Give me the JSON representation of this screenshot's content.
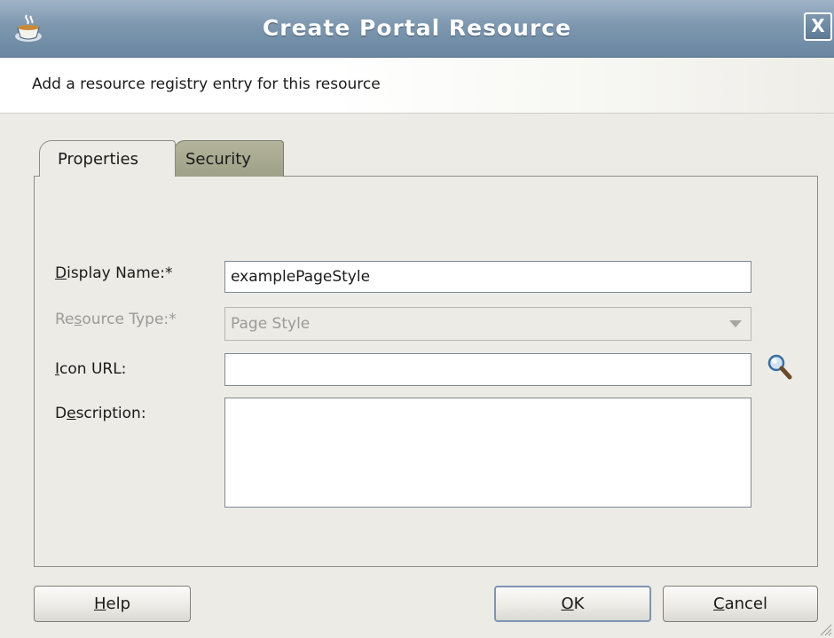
{
  "window": {
    "title": "Create Portal Resource",
    "close_label": "X"
  },
  "header": {
    "description": "Add a resource registry entry for this resource"
  },
  "tabs": [
    {
      "label": "Properties",
      "selected": true
    },
    {
      "label": "Security",
      "selected": false
    }
  ],
  "form": {
    "display_name": {
      "label_mnemonic": "D",
      "label_rest": "isplay Name:*",
      "value": "examplePageStyle"
    },
    "resource_type": {
      "label_pre": "Re",
      "label_mnemonic": "s",
      "label_rest": "ource Type:*",
      "value": "Page Style",
      "enabled": false
    },
    "icon_url": {
      "label_mnemonic": "I",
      "label_rest": "con URL:",
      "value": ""
    },
    "description": {
      "label_pre": "D",
      "label_mnemonic": "e",
      "label_rest": "scription:",
      "value": ""
    }
  },
  "buttons": {
    "help": {
      "mnemonic": "H",
      "rest": "elp"
    },
    "ok": {
      "mnemonic": "O",
      "rest": "K"
    },
    "cancel": {
      "mnemonic": "C",
      "rest": "ancel"
    }
  },
  "colors": {
    "titlebar": "#7d97af",
    "background": "#ecebe6",
    "security_tab": "#a9aa91",
    "ok_focus_border": "#7d96b2"
  },
  "icons": {
    "title": "coffee-cup-icon",
    "browse": "magnifier-icon",
    "resize": "resize-grip-icon"
  }
}
